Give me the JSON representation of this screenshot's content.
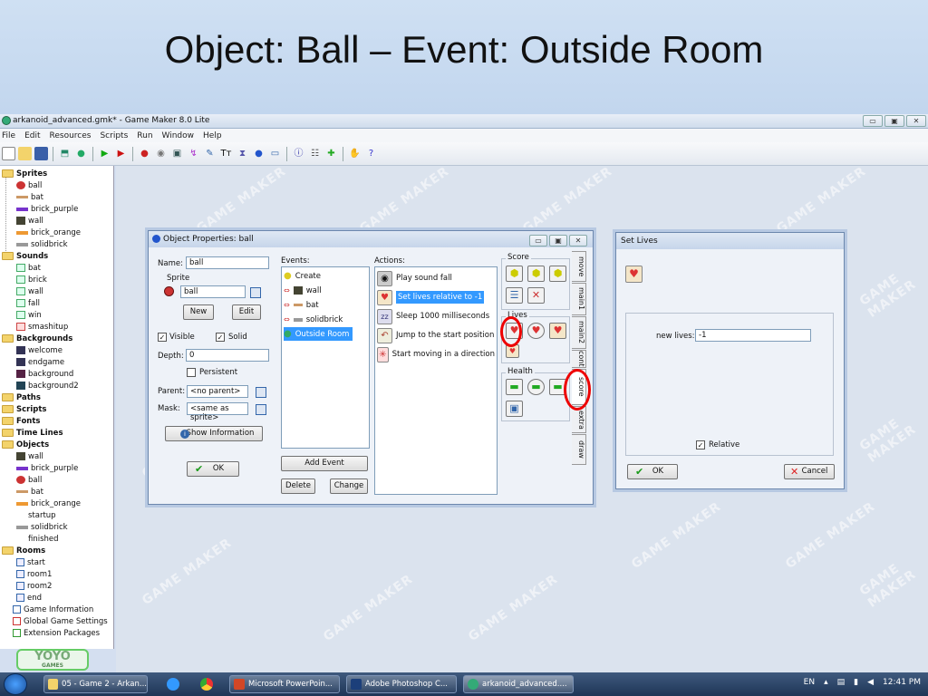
{
  "slide": {
    "title": "Object: Ball – Event: Outside Room"
  },
  "window": {
    "title": "arkanoid_advanced.gmk* - Game Maker 8.0 Lite",
    "buttons": {
      "minimize": "▭",
      "maximize": "▣",
      "close": "✕"
    },
    "menu": [
      "File",
      "Edit",
      "Resources",
      "Scripts",
      "Run",
      "Window",
      "Help"
    ]
  },
  "tree": {
    "sprites": "Sprites",
    "sprite_items": [
      "ball",
      "bat",
      "brick_purple",
      "wall",
      "brick_orange",
      "solidbrick"
    ],
    "sounds": "Sounds",
    "sound_items": [
      "bat",
      "brick",
      "wall",
      "fall",
      "win",
      "smashitup"
    ],
    "backgrounds": "Backgrounds",
    "background_items": [
      "welcome",
      "endgame",
      "background",
      "background2"
    ],
    "paths": "Paths",
    "scripts": "Scripts",
    "fonts": "Fonts",
    "timelines": "Time Lines",
    "objects": "Objects",
    "object_items": [
      "wall",
      "brick_purple",
      "ball",
      "bat",
      "brick_orange",
      "startup",
      "solidbrick",
      "finished"
    ],
    "rooms": "Rooms",
    "room_items": [
      "start",
      "room1",
      "room2",
      "end"
    ],
    "extra": [
      "Game Information",
      "Global Game Settings",
      "Extension Packages"
    ]
  },
  "logo": {
    "text": "YOYO",
    "sub": "GAMES"
  },
  "object_props": {
    "title": "Object Properties: ball",
    "name_label": "Name:",
    "name_value": "ball",
    "sprite_label": "Sprite",
    "sprite_value": "ball",
    "new_btn": "New",
    "edit_btn": "Edit",
    "visible_label": "Visible",
    "solid_label": "Solid",
    "depth_label": "Depth:",
    "depth_value": "0",
    "persistent_label": "Persistent",
    "parent_label": "Parent:",
    "parent_value": "<no parent>",
    "mask_label": "Mask:",
    "mask_value": "<same as sprite>",
    "show_info_btn": "Show Information",
    "ok_btn": "OK",
    "events_label": "Events:",
    "events": [
      "Create",
      "wall",
      "bat",
      "solidbrick",
      "Outside Room"
    ],
    "add_event_btn": "Add Event",
    "delete_btn": "Delete",
    "change_btn": "Change",
    "actions_label": "Actions:",
    "actions": [
      "Play sound fall",
      "Set lives relative to -1",
      "Sleep 1000 milliseconds",
      "Jump to the start position",
      "Start moving in a direction"
    ],
    "palette_groups": {
      "score": "Score",
      "lives": "Lives",
      "health": "Health"
    },
    "tabs": [
      "move",
      "main1",
      "main2",
      "control",
      "score",
      "extra",
      "draw"
    ]
  },
  "set_lives": {
    "title": "Set Lives",
    "new_lives_label": "new lives:",
    "new_lives_value": "-1",
    "relative_label": "Relative",
    "ok_btn": "OK",
    "cancel_btn": "Cancel"
  },
  "taskbar": {
    "items": [
      "05 - Game 2 - Arkan...",
      "Microsoft PowerPoin...",
      "Adobe Photoshop C...",
      "arkanoid_advanced...."
    ],
    "lang": "EN",
    "time": "12:41 PM"
  },
  "watermark": "GAME MAKER",
  "colors": {
    "accent_red": "#e00000",
    "selection": "#3399ff"
  }
}
